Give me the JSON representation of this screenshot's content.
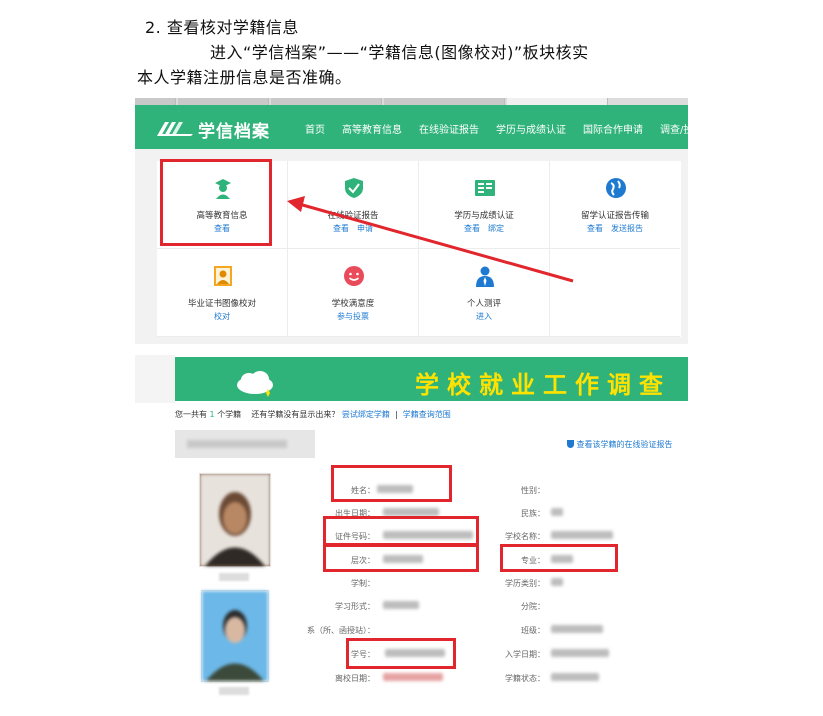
{
  "document": {
    "heading": "2. 查看核对学籍信息",
    "para_line1": "进入“学信档案”——“学籍信息(图像校对)”板块核实",
    "para_line2": "本人学籍注册信息是否准确。"
  },
  "site": {
    "logo_text": "学信档案",
    "nav": [
      "首页",
      "高等教育信息",
      "在线验证报告",
      "学历与成绩认证",
      "国际合作申请",
      "调查/投票"
    ]
  },
  "services": [
    {
      "name": "高等教育信息",
      "links": [
        "查看"
      ],
      "icon": "graduate-icon",
      "color": "#2fb37a"
    },
    {
      "name": "在线验证报告",
      "links": [
        "查看",
        "申请"
      ],
      "icon": "shield-check-icon",
      "color": "#2fb37a"
    },
    {
      "name": "学历与成绩认证",
      "links": [
        "查看",
        "绑定"
      ],
      "icon": "certificate-icon",
      "color": "#2fb37a"
    },
    {
      "name": "留学认证报告传输",
      "links": [
        "查看",
        "发送报告"
      ],
      "icon": "globe-icon",
      "color": "#1e7ad1"
    },
    {
      "name": "毕业证书图像校对",
      "links": [
        "校对"
      ],
      "icon": "id-photo-icon",
      "color": "#f5a623"
    },
    {
      "name": "学校满意度",
      "links": [
        "参与投票"
      ],
      "icon": "smiley-icon",
      "color": "#e94b5b"
    },
    {
      "name": "个人测评",
      "links": [
        "进入"
      ],
      "icon": "person-icon",
      "color": "#1e7ad1"
    }
  ],
  "survey": {
    "banner_title": "学校就业工作调查",
    "count_prefix": "您一共有",
    "count_value": "1",
    "count_suffix": "个学籍",
    "missing_text": "还有学籍没有显示出来？",
    "bind_link": "尝试绑定学籍",
    "separator": "|",
    "scope_link": "学籍查询范围",
    "verify_link": "查看该学籍的在线验证报告",
    "fields": {
      "name": "姓名：",
      "gender": "性别：",
      "birth": "出生日期：",
      "ethnicity": "民族：",
      "id_number": "证件号码：",
      "school": "学校名称：",
      "level": "层次：",
      "major": "专业：",
      "duration": "学制：",
      "category": "学历类别：",
      "study_form": "学习形式：",
      "branch": "分院：",
      "department": "系（所、函授站）：",
      "class": "班级：",
      "student_no": "学号：",
      "enroll_date": "入学日期：",
      "leave_date": "离校日期：",
      "status": "学籍状态："
    }
  },
  "colors": {
    "brand_green": "#2fb37a",
    "link_blue": "#1e7ad1",
    "highlight_red": "#e1262d",
    "banner_text": "#ffe200"
  }
}
